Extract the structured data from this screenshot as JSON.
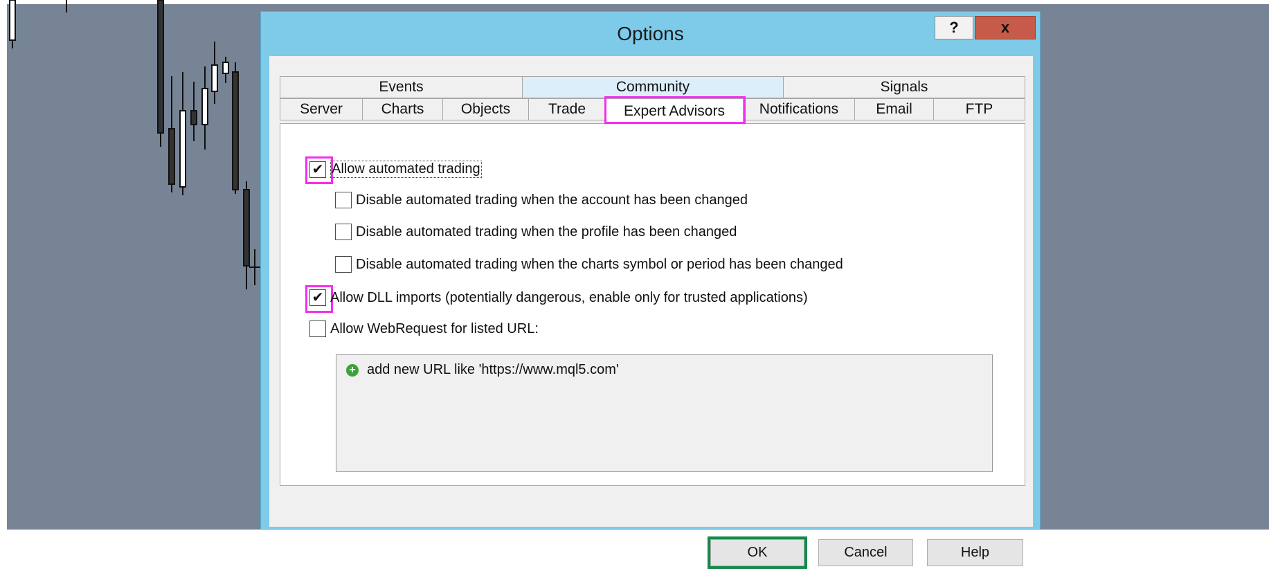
{
  "dialog": {
    "title": "Options",
    "help_button": "?",
    "close_button": "x"
  },
  "tabs": {
    "row1": [
      "Events",
      "Community",
      "Signals"
    ],
    "row2": [
      "Server",
      "Charts",
      "Objects",
      "Trade",
      "Expert Advisors",
      "Notifications",
      "Email",
      "FTP"
    ],
    "active": "Expert Advisors"
  },
  "options": {
    "allow_automated": {
      "label": "Allow automated trading",
      "checked": true
    },
    "disable_account": {
      "label": "Disable automated trading when the account has been changed",
      "checked": false
    },
    "disable_profile": {
      "label": "Disable automated trading when the profile has been changed",
      "checked": false
    },
    "disable_symbol": {
      "label": "Disable automated trading when the charts symbol or period has been changed",
      "checked": false
    },
    "allow_dll": {
      "label": "Allow DLL imports (potentially dangerous, enable only for trusted applications)",
      "checked": true
    },
    "allow_webrequest": {
      "label": "Allow WebRequest for listed URL:",
      "checked": false
    }
  },
  "url_list": {
    "add_new": "add new URL like 'https://www.mql5.com'"
  },
  "buttons": {
    "ok": "OK",
    "cancel": "Cancel",
    "help": "Help"
  },
  "colors": {
    "annotation_pink": "#f52ef0",
    "annotation_green": "#13894a",
    "title_bar": "#7dcbe9",
    "close_button": "#c75b4a",
    "chart_background": "#768496"
  },
  "icons": {
    "check": "checkmark-icon",
    "add_url": "plus-circle-icon"
  }
}
